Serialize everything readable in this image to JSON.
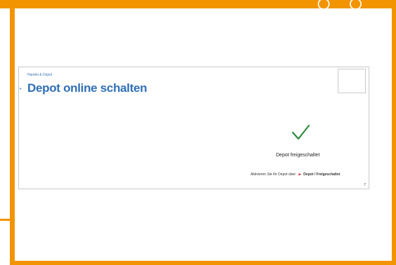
{
  "slide": {
    "breadcrumb": "Handel & Depot",
    "title": "Depot online schalten",
    "status": "Depot freigeschaltet",
    "path_prefix": "Aktivieren Sie Ihr Depot über:",
    "path_sep": "▶",
    "path_target": "Depot / Freigeschaltet",
    "page_number": "7"
  },
  "colors": {
    "frame": "#f29400",
    "title": "#2f6fb7",
    "check": "#2e8b3a"
  }
}
